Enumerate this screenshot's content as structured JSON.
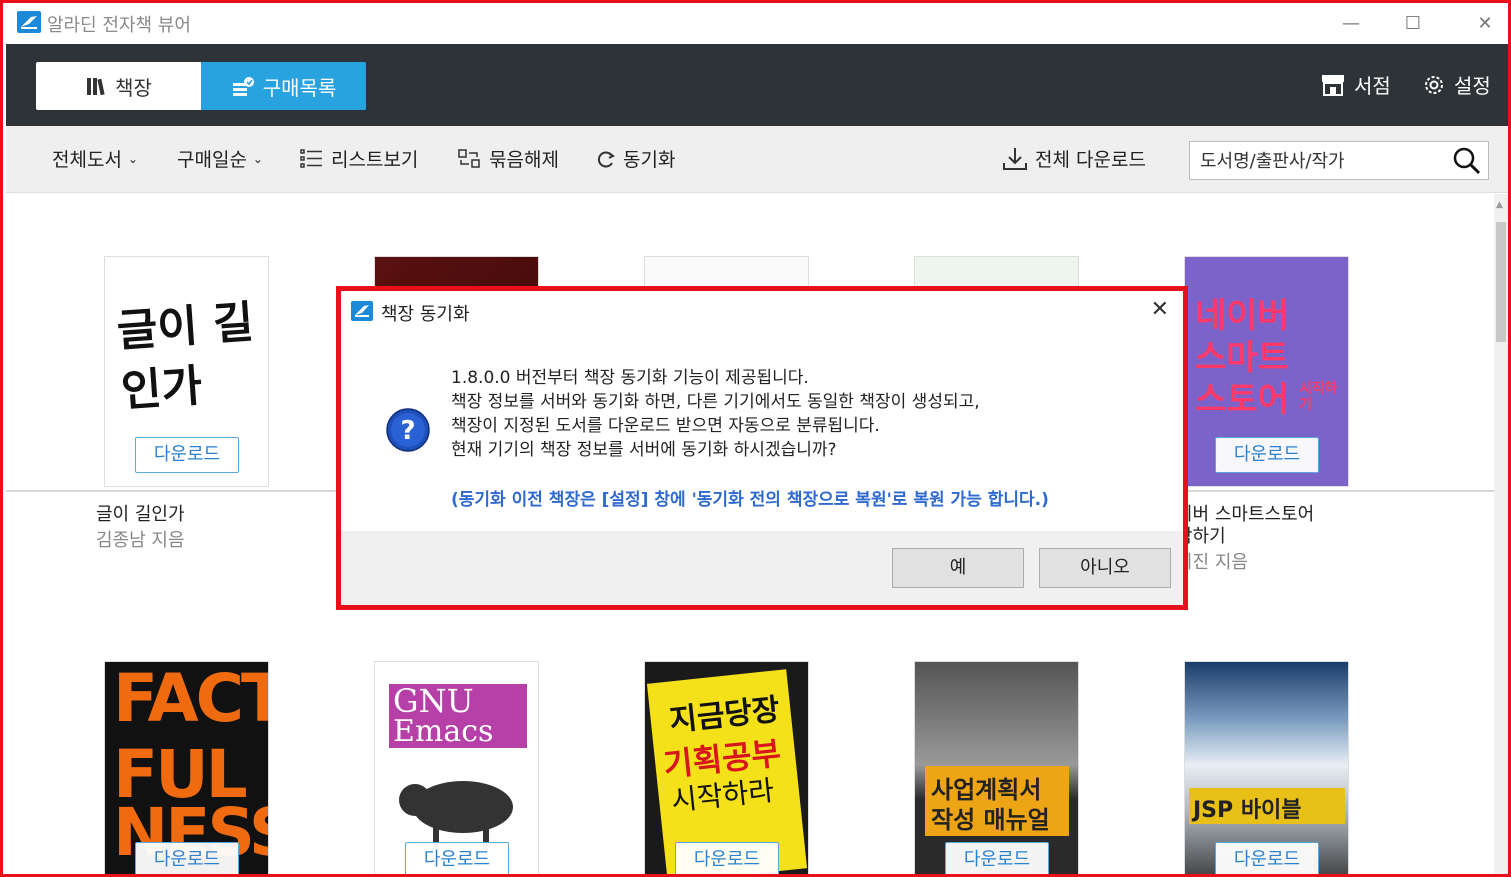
{
  "app": {
    "title": "알라딘 전자책 뷰어",
    "window_controls": [
      "minimize",
      "maximize",
      "close"
    ]
  },
  "header": {
    "tabs": [
      {
        "label": "책장",
        "icon": "bookshelf-icon",
        "selected": false
      },
      {
        "label": "구매목록",
        "icon": "purchase-list-icon",
        "selected": true
      }
    ],
    "store_label": "서점",
    "settings_label": "설정"
  },
  "toolbar": {
    "filter_label": "전체도서",
    "sort_label": "구매일순",
    "list_view_label": "리스트보기",
    "ungroup_label": "묶음해제",
    "sync_label": "동기화",
    "download_all_label": "전체 다운로드",
    "search_placeholder": "도서명/출판사/작가"
  },
  "books": {
    "download_label": "다운로드",
    "row1": [
      {
        "title": "글이 길인가",
        "author": "김종남 지음"
      },
      {
        "title": "",
        "author": ""
      },
      {
        "title": "",
        "author": ""
      },
      {
        "title": "",
        "author": ""
      },
      {
        "title_line1": "이버 스마트스토어",
        "title_line2": "작하기",
        "author": "미진 지음"
      }
    ],
    "covers": {
      "book1_text": "글이 길인가",
      "book5_text_1": "네이버",
      "book5_text_2": "스마트",
      "book5_text_3": "스토어",
      "book5_small": "시작하기",
      "fact_1": "FACT",
      "fact_2": "FUL",
      "fact_3": "NESS",
      "gnu_1": "GNU",
      "gnu_2": "Emacs",
      "plan_1": "지금당장",
      "plan_2": "기획공부",
      "plan_3": "시작하라",
      "biz_1": "사업계획서",
      "biz_2": "작성 매뉴얼",
      "jsp_1": "JSP 바이블"
    }
  },
  "dialog": {
    "title": "책장 동기화",
    "lines": [
      "1.8.0.0 버전부터 책장 동기화 기능이 제공됩니다.",
      "책장 정보를 서버와 동기화 하면, 다른 기기에서도 동일한 책장이 생성되고,",
      "책장이 지정된 도서를 다운로드 받으면 자동으로 분류됩니다.",
      "현재 기기의 책장 정보를 서버에 동기화 하시겠습니까?"
    ],
    "note": "(동기화 이전 책장은 [설정] 창에 '동기화 전의 책장으로 복원'로 복원 가능 합니다.)",
    "yes_label": "예",
    "no_label": "아니오"
  },
  "colors": {
    "header_bg": "#2e3338",
    "accent": "#29a3e0",
    "highlight_border": "#e8101a",
    "note_text": "#2f6ad0"
  }
}
